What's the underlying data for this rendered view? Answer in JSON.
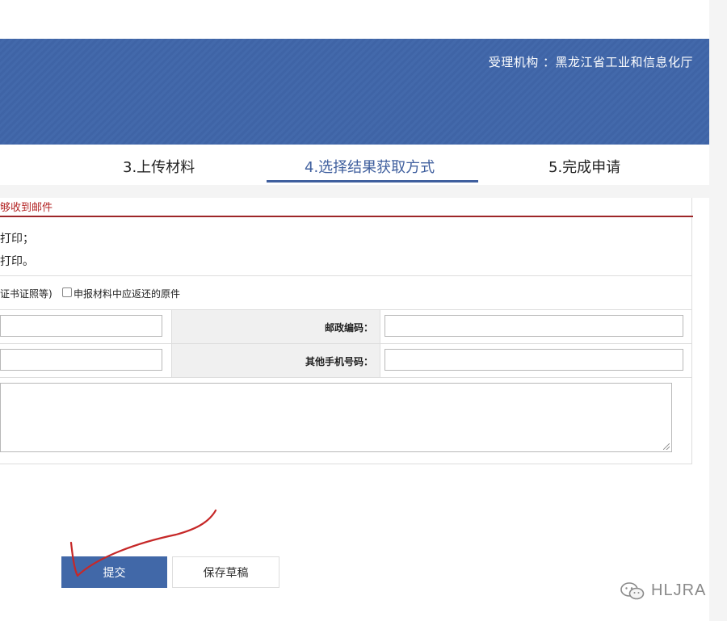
{
  "header": {
    "agency": "受理机构 ：黑龙江省工业和信息化厅"
  },
  "steps": [
    {
      "label": "3.上传材料",
      "active": false
    },
    {
      "label": "4.选择结果获取方式",
      "active": true
    },
    {
      "label": "5.完成申请",
      "active": false
    }
  ],
  "notice": {
    "title": "够收到邮件",
    "lines": [
      "打印；",
      "打印。"
    ]
  },
  "mail_options": {
    "text_before": "证书证照等)",
    "checkbox_label": "申报材料中应返还的原件",
    "checked": false
  },
  "fields": {
    "postal_code_label": "邮政编码：",
    "postal_code_value": "",
    "other_phone_label": "其他手机号码：",
    "other_phone_value": ""
  },
  "buttons": {
    "submit": "提交",
    "save_draft": "保存草稿"
  },
  "watermark": {
    "text": "HLJRA"
  },
  "colors": {
    "header_blue": "#3f64a6",
    "accent_red": "#9d2628",
    "button_blue": "#4168a8"
  }
}
